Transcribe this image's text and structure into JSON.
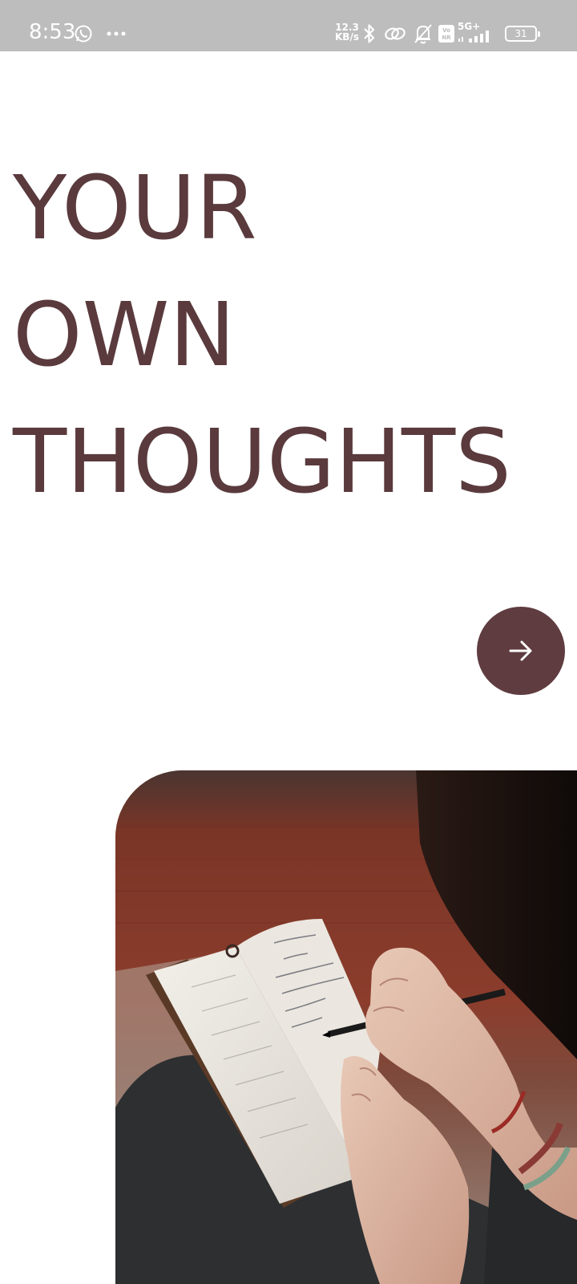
{
  "status_bar": {
    "time": "8:53",
    "net_speed_value": "12.3",
    "net_speed_unit": "KB/s",
    "network_type": "5G+",
    "battery": "31",
    "icons": [
      "whatsapp-icon",
      "more-dots-icon",
      "bluetooth-icon",
      "link-icon",
      "bell-off-icon",
      "volte-icon",
      "signal-icon",
      "battery-icon"
    ]
  },
  "hero": {
    "line1": "YOUR",
    "line2": "OWN",
    "line3": "THOUGHTS"
  },
  "next_button": {
    "icon": "arrow-right-icon"
  },
  "photo": {
    "subject": "hands-writing-in-notebook-photo"
  },
  "colors": {
    "headline": "#5a3a3d",
    "accent": "#5f3c40",
    "status_bar": "#bdbdbd",
    "background": "#ffffff"
  }
}
